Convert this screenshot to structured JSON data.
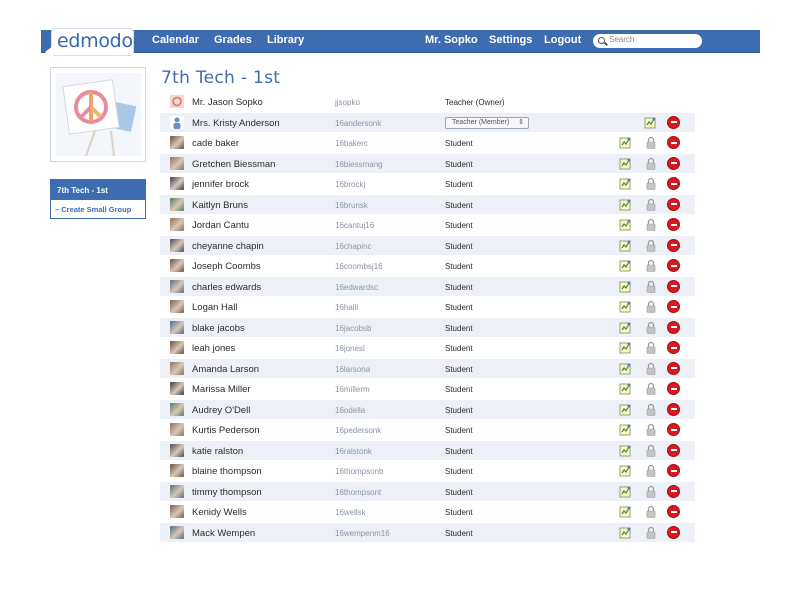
{
  "header": {
    "logo_text": "edmodo",
    "nav": {
      "calendar": "Calendar",
      "grades": "Grades",
      "library": "Library"
    },
    "user": "Mr. Sopko",
    "settings": "Settings",
    "logout": "Logout",
    "search_placeholder": "Search"
  },
  "sidebar": {
    "active_group": "7th Tech - 1st",
    "create_small_group": "– Create Small Group"
  },
  "main": {
    "title": "7th Tech - 1st",
    "member_role_option": "Teacher (Member)",
    "role_select_arrows": "⇕",
    "members": [
      {
        "name": "Mr. Jason Sopko",
        "username": "jjsopko",
        "role": "Teacher (Owner)",
        "kind": "owner"
      },
      {
        "name": "Mrs. Kristy Anderson",
        "username": "16andersonk",
        "role": "Teacher (Member)",
        "kind": "member"
      },
      {
        "name": "cade baker",
        "username": "16bakerc",
        "role": "Student",
        "kind": "student"
      },
      {
        "name": "Gretchen Biessman",
        "username": "16biessmang",
        "role": "Student",
        "kind": "student"
      },
      {
        "name": "jennifer brock",
        "username": "16brockj",
        "role": "Student",
        "kind": "student"
      },
      {
        "name": "Kaitlyn Bruns",
        "username": "16brunsk",
        "role": "Student",
        "kind": "student"
      },
      {
        "name": "Jordan Cantu",
        "username": "16cantuj16",
        "role": "Student",
        "kind": "student"
      },
      {
        "name": "cheyanne chapin",
        "username": "16chapinc",
        "role": "Student",
        "kind": "student"
      },
      {
        "name": "Joseph Coombs",
        "username": "16coombsj16",
        "role": "Student",
        "kind": "student"
      },
      {
        "name": "charles edwards",
        "username": "16edwardsc",
        "role": "Student",
        "kind": "student"
      },
      {
        "name": "Logan Hall",
        "username": "16halll",
        "role": "Student",
        "kind": "student"
      },
      {
        "name": "blake jacobs",
        "username": "16jacobsb",
        "role": "Student",
        "kind": "student"
      },
      {
        "name": "leah jones",
        "username": "16jonesl",
        "role": "Student",
        "kind": "student"
      },
      {
        "name": "Amanda Larson",
        "username": "16larsona",
        "role": "Student",
        "kind": "student"
      },
      {
        "name": "Marissa Miller",
        "username": "16millerm",
        "role": "Student",
        "kind": "student"
      },
      {
        "name": "Audrey O'Dell",
        "username": "16odella",
        "role": "Student",
        "kind": "student"
      },
      {
        "name": "Kurtis Pederson",
        "username": "16pedersonk",
        "role": "Student",
        "kind": "student"
      },
      {
        "name": "katie ralston",
        "username": "16ralstonk",
        "role": "Student",
        "kind": "student"
      },
      {
        "name": "blaine thompson",
        "username": "16thompsonb",
        "role": "Student",
        "kind": "student"
      },
      {
        "name": "timmy thompson",
        "username": "16thompsont",
        "role": "Student",
        "kind": "student"
      },
      {
        "name": "Kenidy Wells",
        "username": "16wellsk",
        "role": "Student",
        "kind": "student"
      },
      {
        "name": "Mack Wempen",
        "username": "16wempenm16",
        "role": "Student",
        "kind": "student"
      }
    ]
  },
  "colors": {
    "brand": "#3e6cb0",
    "row_alt": "#edf1f7",
    "remove": "#d71920"
  }
}
